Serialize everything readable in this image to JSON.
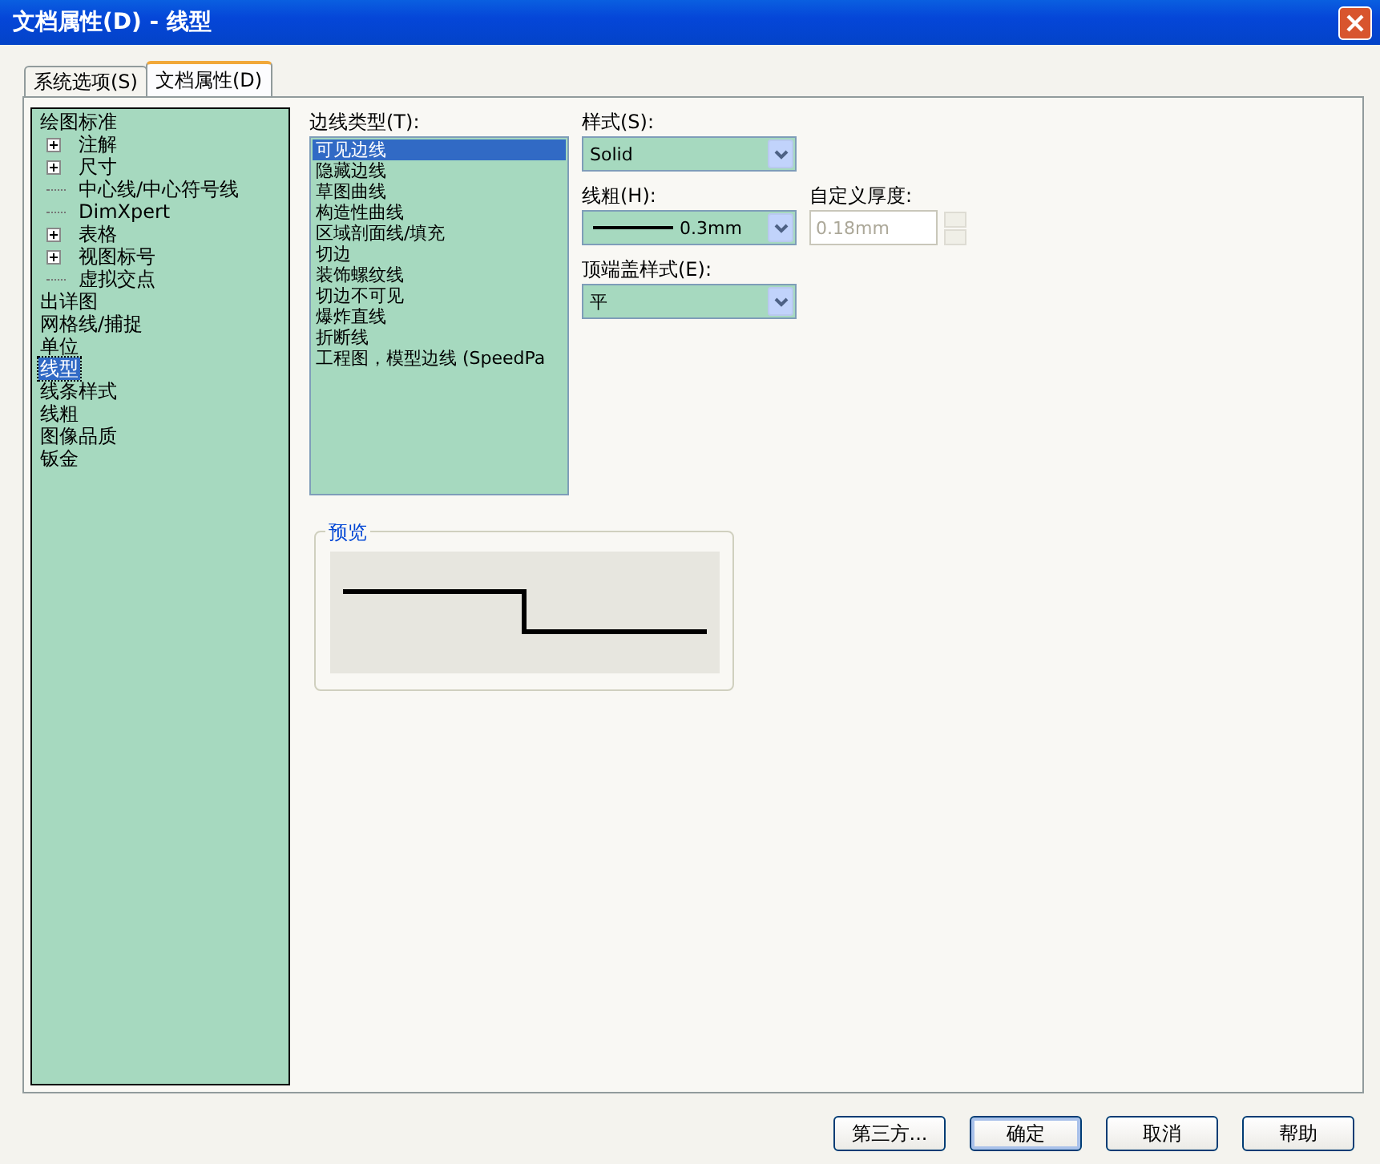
{
  "window": {
    "title": "文档属性(D) - 线型"
  },
  "tabs": [
    {
      "label": "系统选项(S)",
      "selected": false
    },
    {
      "label": "文档属性(D)",
      "selected": true
    }
  ],
  "tree": [
    {
      "label": "绘图标准",
      "selected": false,
      "children": [
        {
          "label": "注解",
          "expanded": false,
          "selected": false
        },
        {
          "label": "尺寸",
          "expanded": false,
          "selected": false
        },
        {
          "label": "中心线/中心符号线",
          "selected": false
        },
        {
          "label": "DimXpert",
          "selected": false
        },
        {
          "label": "表格",
          "expanded": false,
          "selected": false
        },
        {
          "label": "视图标号",
          "expanded": false,
          "selected": false
        },
        {
          "label": "虚拟交点",
          "selected": false
        }
      ]
    },
    {
      "label": "出详图",
      "selected": false
    },
    {
      "label": "网格线/捕捉",
      "selected": false
    },
    {
      "label": "单位",
      "selected": false
    },
    {
      "label": "线型",
      "selected": true
    },
    {
      "label": "线条样式",
      "selected": false
    },
    {
      "label": "线粗",
      "selected": false
    },
    {
      "label": "图像品质",
      "selected": false
    },
    {
      "label": "钣金",
      "selected": false
    }
  ],
  "edge_types": {
    "label": "边线类型(T):",
    "items": [
      {
        "label": "可见边线",
        "selected": true
      },
      {
        "label": "隐藏边线",
        "selected": false
      },
      {
        "label": "草图曲线",
        "selected": false
      },
      {
        "label": "构造性曲线",
        "selected": false
      },
      {
        "label": "区域剖面线/填充",
        "selected": false
      },
      {
        "label": "切边",
        "selected": false
      },
      {
        "label": "装饰螺纹线",
        "selected": false
      },
      {
        "label": "切边不可见",
        "selected": false
      },
      {
        "label": "爆炸直线",
        "selected": false
      },
      {
        "label": "折断线",
        "selected": false
      },
      {
        "label": "工程图，模型边线 (SpeedPa",
        "selected": false
      }
    ]
  },
  "style": {
    "label": "样式(S):",
    "value": "Solid"
  },
  "weight": {
    "label": "线粗(H):",
    "value": "0.3mm"
  },
  "custom_thickness": {
    "label": "自定义厚度:",
    "value": "0.18mm",
    "disabled": true
  },
  "end_cap": {
    "label": "顶端盖样式(E):",
    "value": "平"
  },
  "preview": {
    "label": "预览"
  },
  "buttons": [
    {
      "label": "第三方...",
      "default": false
    },
    {
      "label": "确定",
      "default": true
    },
    {
      "label": "取消",
      "default": false
    },
    {
      "label": "帮助",
      "default": false
    }
  ]
}
